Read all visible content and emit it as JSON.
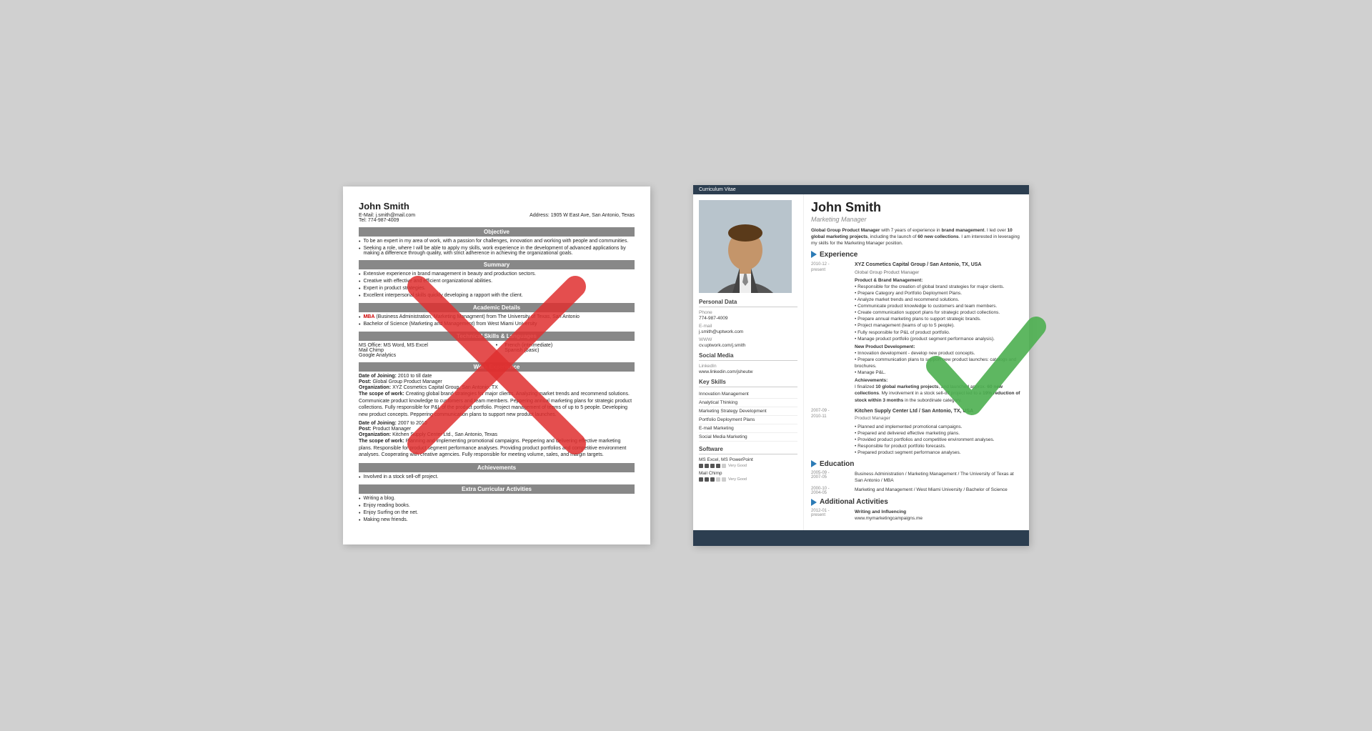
{
  "left_resume": {
    "name": "John Smith",
    "email": "E-Mail: j.smith@mail.com",
    "tel": "Tel: 774-987-4009",
    "address": "Address: 1905 W East Ave, San Antonio, Texas",
    "sections": {
      "objective": {
        "title": "Objective",
        "bullets": [
          "To be an expert in my area of work, with a passion for challenges, innovation and working with people and communities.",
          "Seeking a role, where I will be able to apply my skills, work experience in the development of advanced applications by making a difference through quality, with strict adherence in achieving the organizational goals."
        ]
      },
      "summary": {
        "title": "Summary",
        "bullets": [
          "Extensive experience in brand management in beauty and production sectors.",
          "Creative with effective and efficient organizational abilities.",
          "Expert in product strategies.",
          "Excellent interpersonal skills quickly developing a rapport with the client."
        ]
      },
      "academic": {
        "title": "Academic Details",
        "items": [
          "MBA (Business Administration, Marketing Managment) from The University of Texas, San Antonio",
          "Bachelor of Science (Marketing and Management) from West Miami University"
        ]
      },
      "technical": {
        "title": "Technical Skills & Languages",
        "col1": [
          "MS Office: MS Word, MS Excel",
          "Mail Chimp",
          "Google Analytics"
        ],
        "col2": [
          "French (intermediate)",
          "Spanish (basic)"
        ]
      },
      "work": {
        "title": "Work Experience",
        "jobs": [
          {
            "date_of_joining": "Date of Joining: 2010 to till date",
            "post": "Post: Global Group Product Manager",
            "organization": "Organization: XYZ Cosmetics Capital Group, San Antonio, TX",
            "scope": "The scope of work: Creating global brand strategies for major clients. Analyzing market trends and recommend solutions. Communicate product knowledge to customers and team members. Peppering annual marketing plans for strategic product collections. Fully responsible for P&L of the product portfolio. Project management of teams of up to 5 people. Developing new product concepts. Peppering communication plans to support new product launches."
          },
          {
            "date_of_joining": "Date of Joining: 2007 to 2010",
            "post": "Post: Product Manager",
            "organization": "Organization: Kitchen Supply Center Ltd., San Antonio, Texas",
            "scope": "The scope of work: Planning and implementing promotional campaigns. Peppering and delivering effective marketing plans. Responsible for product segment performance analyses. Providing product portfolios and competitive environment analyses. Cooperating with creative agencies. Fully responsible for meeting volume, sales, and margin targets."
          }
        ]
      },
      "achievements": {
        "title": "Achievements",
        "bullets": [
          "Involved in a stock sell-off project."
        ]
      },
      "extra": {
        "title": "Extra Curricular Activities",
        "bullets": [
          "Writing a blog.",
          "Enjoy reading books.",
          "Enjoy Surfing on the net.",
          "Making new friends."
        ]
      }
    }
  },
  "right_resume": {
    "cv_label": "Curriculum Vitae",
    "name": "John Smith",
    "title": "Marketing Manager",
    "summary": "Global Group Product Manager with 7 years of experience in brand management. I led over 10 global marketing projects, including the launch of 60 new collections. I am interested in leveraging my skills for the Marketing Manager position.",
    "personal_data": {
      "section_title": "Personal Data",
      "phone_label": "Phone",
      "phone": "774-987-4009",
      "email_label": "E-mail",
      "email": "j.smith@uptwork.com",
      "www_label": "WWW",
      "www": "cv.uptwork.com/j.smith"
    },
    "social_media": {
      "section_title": "Social Media",
      "linkedin_label": "LinkedIn",
      "linkedin": "www.linkedin.com/jsheutw"
    },
    "key_skills": {
      "section_title": "Key Skills",
      "items": [
        "Innovation Management",
        "Analytical Thinking",
        "Marketing Strategy Development",
        "Portfolio Deployment Plans",
        "E-mail Marketing",
        "Social Media Marketing"
      ]
    },
    "software": {
      "section_title": "Software",
      "items": [
        {
          "name": "MS Excel, MS PowerPoint",
          "level": 4,
          "max": 5,
          "label": "Very Good"
        },
        {
          "name": "Mail Chimp",
          "level": 3,
          "max": 5,
          "label": "Very Good"
        }
      ]
    },
    "experience": {
      "section_title": "Experience",
      "jobs": [
        {
          "date_start": "2010-12 -",
          "date_end": "present",
          "company": "XYZ Cosmetics Capital Group / San Antonio, TX, USA",
          "role": "Global Group Product Manager",
          "subsections": [
            {
              "title": "Product & Brand Management:",
              "bullets": [
                "Responsible for the creation of global brand strategies for major clients.",
                "Prepare Category and Portfolio Deployment Plans.",
                "Analyze market trends and recommend solutions.",
                "Communicate product knowledge to customers and team members.",
                "Create communication support plans for strategic product collections.",
                "Prepare annual marketing plans to support strategic brands.",
                "Project management (teams of up to 5 people).",
                "Fully responsible for P&L of product portfolio.",
                "Manage product portfolio (product segment performance analysis)."
              ]
            },
            {
              "title": "New Product Development:",
              "bullets": [
                "Innovation development - develop new product concepts.",
                "Prepare communication plans to support new product launches: catalogs and brochures.",
                "Manage P&L."
              ]
            },
            {
              "title": "Achievements:",
              "text": "I finalized 10 global marketing projects, and launched approx. 60 new collections. My involvement in a stock sell-off project led to a 19% reduction of stock within 3 months in the subordinate category."
            }
          ]
        },
        {
          "date_start": "2007-09 -",
          "date_end": "2010-11",
          "company": "Kitchen Supply Center Ltd / San Antonio, TX, USA",
          "role": "Product Manager",
          "bullets": [
            "Planned and implemented promotional campaigns.",
            "Prepared and delivered effective marketing plans.",
            "Provided product portfolios and competitive environment analyses.",
            "Responsible for product portfolio forecasts.",
            "Prepared product segment performance analyses."
          ]
        }
      ]
    },
    "education": {
      "section_title": "Education",
      "items": [
        {
          "date_start": "2005-09 -",
          "date_end": "2007-05",
          "content": "Business Administration / Marketing Management / The University of Texas at San Antonio / MBA"
        },
        {
          "date_start": "2000-10 -",
          "date_end": "2004-05",
          "content": "Marketing and Management / West Miami University / Bachelor of Science"
        }
      ]
    },
    "additional": {
      "section_title": "Additional Activities",
      "items": [
        {
          "date_start": "2012-01 -",
          "date_end": "present",
          "title": "Writing and Influencing",
          "detail": "www.mymarketingcampaigns.me"
        }
      ]
    }
  }
}
